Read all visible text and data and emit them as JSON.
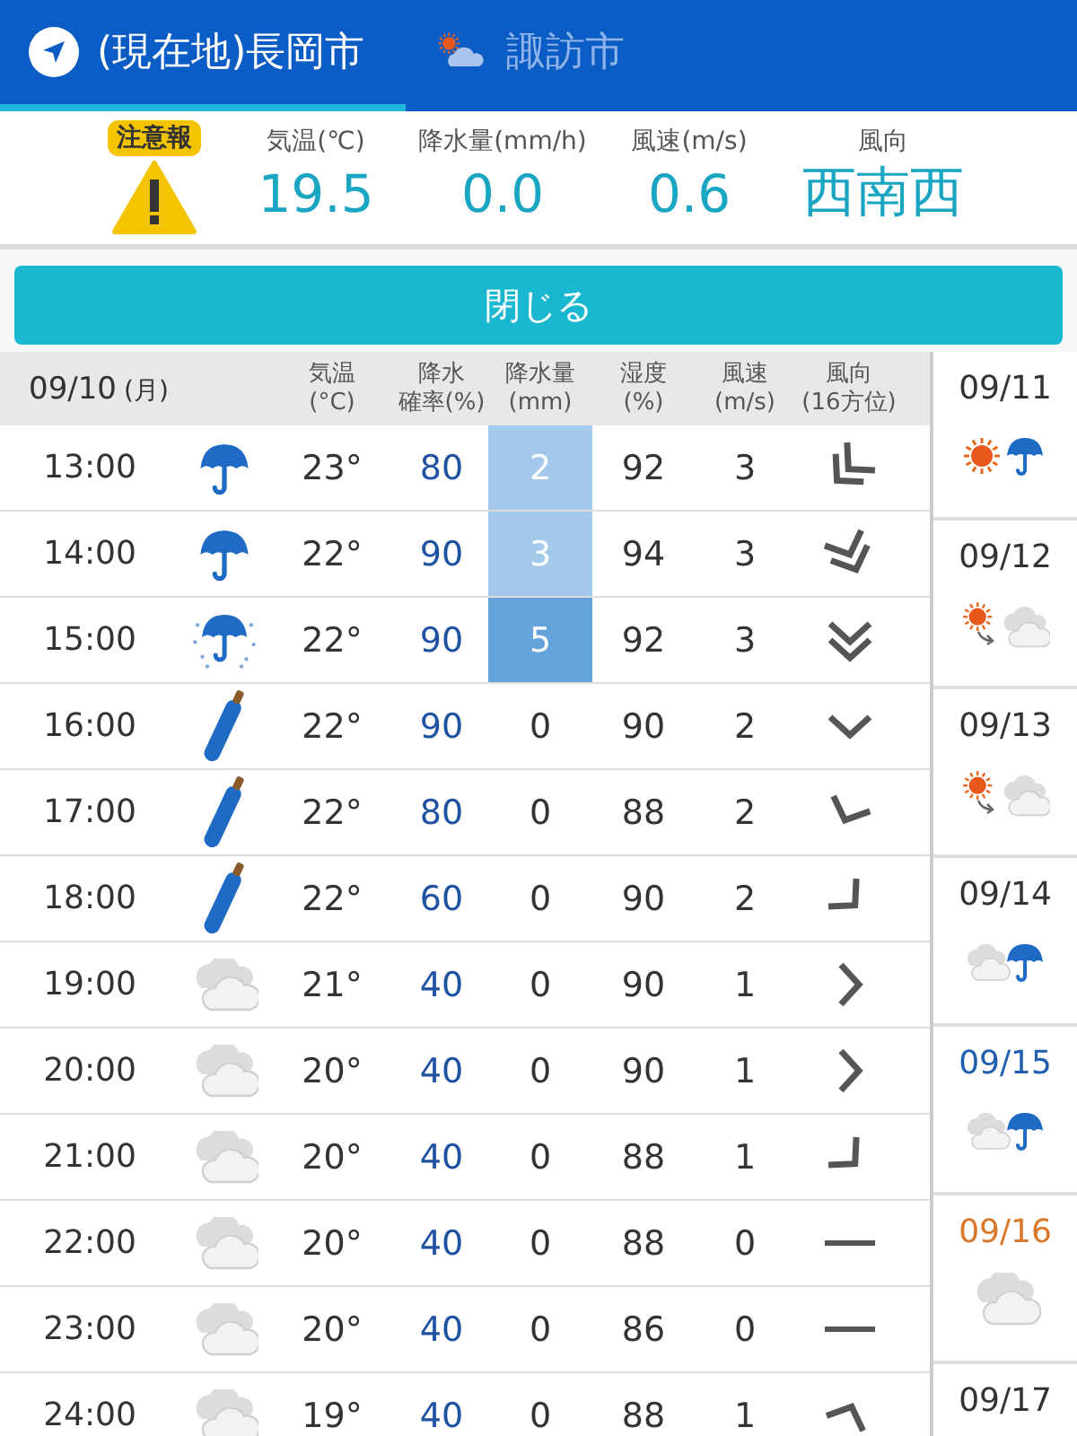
{
  "tabs": [
    {
      "label": "(現在地)長岡市",
      "icon": {
        "kind": "location"
      },
      "selected": true
    },
    {
      "label": "諏訪市",
      "icon": {
        "kind": "cloud_sun"
      },
      "selected": false
    }
  ],
  "summary": {
    "alert": {
      "badge": "注意報"
    },
    "stats": [
      {
        "label": "気温(℃)",
        "value": "19.5"
      },
      {
        "label": "降水量(mm/h)",
        "value": "0.0"
      },
      {
        "label": "風速(m/s)",
        "value": "0.6"
      },
      {
        "label": "風向",
        "value": "西南西"
      }
    ]
  },
  "close_button": "閉じる",
  "table": {
    "date": "09/10",
    "weekday": "(月)",
    "columns": [
      {
        "line1": "気温",
        "line2": "(°C)"
      },
      {
        "line1": "降水",
        "line2": "確率(%)"
      },
      {
        "line1": "降水量",
        "line2": "(mm)"
      },
      {
        "line1": "湿度",
        "line2": "(%)"
      },
      {
        "line1": "風速",
        "line2": "(m/s)"
      },
      {
        "line1": "風向",
        "line2": "(16方位)"
      }
    ],
    "rows": [
      {
        "time": "13:00",
        "weather": {
          "kind": "umbrella"
        },
        "temp": "23°",
        "pop": "80",
        "precip": {
          "value": "2",
          "color": "#a3c9eb"
        },
        "humidity": "92",
        "wind_speed": "3",
        "wind": {
          "kind": "double_sw"
        }
      },
      {
        "time": "14:00",
        "weather": {
          "kind": "umbrella"
        },
        "temp": "22°",
        "pop": "90",
        "precip": {
          "value": "3",
          "color": "#a3c9eb"
        },
        "humidity": "94",
        "wind_speed": "3",
        "wind": {
          "kind": "double_sse"
        }
      },
      {
        "time": "15:00",
        "weather": {
          "kind": "umbrella_rain"
        },
        "temp": "22°",
        "pop": "90",
        "precip": {
          "value": "5",
          "color": "#64a2da"
        },
        "humidity": "92",
        "wind_speed": "3",
        "wind": {
          "kind": "double_s"
        }
      },
      {
        "time": "16:00",
        "weather": {
          "kind": "closed_umbrella"
        },
        "temp": "22°",
        "pop": "90",
        "precip": {
          "value": "0"
        },
        "humidity": "90",
        "wind_speed": "2",
        "wind": {
          "kind": "single_s"
        }
      },
      {
        "time": "17:00",
        "weather": {
          "kind": "closed_umbrella"
        },
        "temp": "22°",
        "pop": "80",
        "precip": {
          "value": "0"
        },
        "humidity": "88",
        "wind_speed": "2",
        "wind": {
          "kind": "single_ssw"
        }
      },
      {
        "time": "18:00",
        "weather": {
          "kind": "closed_umbrella"
        },
        "temp": "22°",
        "pop": "60",
        "precip": {
          "value": "0"
        },
        "humidity": "90",
        "wind_speed": "2",
        "wind": {
          "kind": "single_se"
        }
      },
      {
        "time": "19:00",
        "weather": {
          "kind": "cloud"
        },
        "temp": "21°",
        "pop": "40",
        "precip": {
          "value": "0"
        },
        "humidity": "90",
        "wind_speed": "1",
        "wind": {
          "kind": "single_e"
        }
      },
      {
        "time": "20:00",
        "weather": {
          "kind": "cloud"
        },
        "temp": "20°",
        "pop": "40",
        "precip": {
          "value": "0"
        },
        "humidity": "90",
        "wind_speed": "1",
        "wind": {
          "kind": "single_e"
        }
      },
      {
        "time": "21:00",
        "weather": {
          "kind": "cloud"
        },
        "temp": "20°",
        "pop": "40",
        "precip": {
          "value": "0"
        },
        "humidity": "88",
        "wind_speed": "1",
        "wind": {
          "kind": "single_se"
        }
      },
      {
        "time": "22:00",
        "weather": {
          "kind": "cloud"
        },
        "temp": "20°",
        "pop": "40",
        "precip": {
          "value": "0"
        },
        "humidity": "88",
        "wind_speed": "0",
        "wind": {
          "kind": "calm"
        }
      },
      {
        "time": "23:00",
        "weather": {
          "kind": "cloud"
        },
        "temp": "20°",
        "pop": "40",
        "precip": {
          "value": "0"
        },
        "humidity": "86",
        "wind_speed": "0",
        "wind": {
          "kind": "calm"
        }
      },
      {
        "time": "24:00",
        "weather": {
          "kind": "cloud"
        },
        "temp": "19°",
        "pop": "40",
        "precip": {
          "value": "0"
        },
        "humidity": "88",
        "wind_speed": "1",
        "wind": {
          "kind": "single_nne"
        }
      }
    ]
  },
  "days": [
    {
      "date": "09/11",
      "color": "#333333",
      "weather": {
        "kind": "sun_umbrella"
      }
    },
    {
      "date": "09/12",
      "color": "#333333",
      "weather": {
        "kind": "sun_to_cloud"
      }
    },
    {
      "date": "09/13",
      "color": "#333333",
      "weather": {
        "kind": "sun_to_cloud"
      }
    },
    {
      "date": "09/14",
      "color": "#333333",
      "weather": {
        "kind": "cloud_umbrella"
      }
    },
    {
      "date": "09/15",
      "color": "#1f5fae",
      "weather": {
        "kind": "cloud_umbrella"
      }
    },
    {
      "date": "09/16",
      "color": "#d9782a",
      "weather": {
        "kind": "cloud"
      }
    },
    {
      "date": "09/17",
      "color": "#333333"
    }
  ]
}
